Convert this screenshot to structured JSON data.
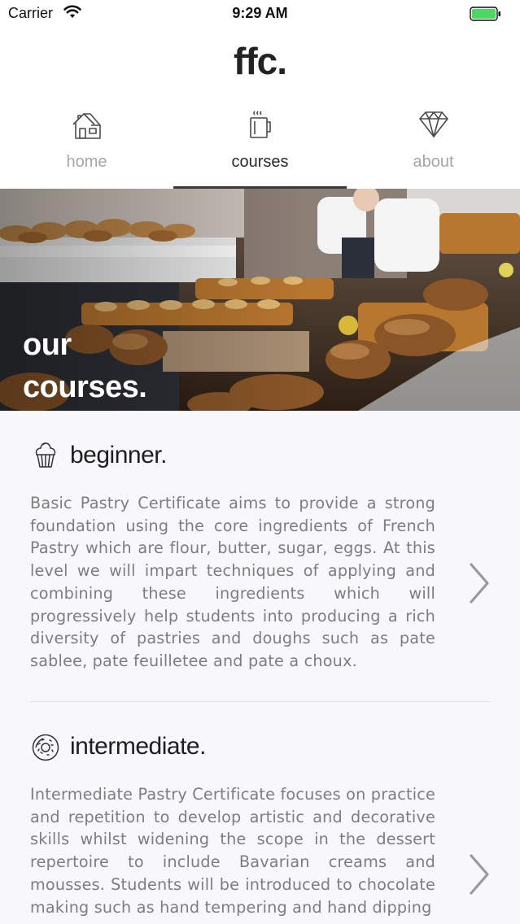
{
  "status_bar": {
    "carrier": "Carrier",
    "time": "9:29 AM",
    "battery_color": "#4cd964"
  },
  "header": {
    "brand": "ffc."
  },
  "tabs": [
    {
      "label": "home",
      "icon": "house-icon",
      "active": false
    },
    {
      "label": "courses",
      "icon": "coffee-cup-icon",
      "active": true
    },
    {
      "label": "about",
      "icon": "diamond-icon",
      "active": false
    }
  ],
  "hero": {
    "title_line1": "our",
    "title_line2": "courses."
  },
  "courses": [
    {
      "title": "beginner.",
      "icon": "cupcake-icon",
      "description": "Basic Pastry Certificate aims to provide a strong foundation using the core ingredients of French Pastry which are flour, butter, sugar, eggs. At this level we will impart techniques of applying and combining these ingredients which will progressively help students into producing a rich diversity of pastries and doughs such as pate sablee, pate feuilletee and pate a choux."
    },
    {
      "title": "intermediate.",
      "icon": "donut-icon",
      "description": "Intermediate Pastry Certificate focuses on practice and repetition to develop artistic and decorative skills whilst widening the scope in the dessert repertoire to include Bavarian creams and mousses. Students will be introduced to chocolate making such as hand tempering and hand dipping"
    }
  ],
  "colors": {
    "active_tab": "#2a2a2a",
    "inactive_tab": "#a6a6a6",
    "list_background": "#f8f8fa",
    "body_text": "#7d7d7d"
  }
}
